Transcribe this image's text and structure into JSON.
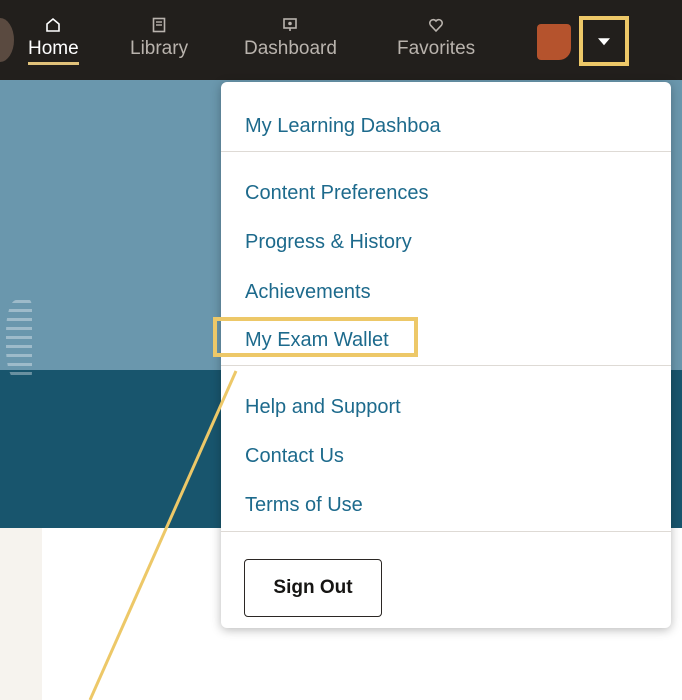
{
  "nav": {
    "items": [
      {
        "label": "Home",
        "icon": "home-icon",
        "active": true
      },
      {
        "label": "Library",
        "icon": "library-icon"
      },
      {
        "label": "Dashboard",
        "icon": "dashboard-icon"
      },
      {
        "label": "Favorites",
        "icon": "heart-icon"
      }
    ]
  },
  "menu": {
    "items": [
      {
        "label": "My Learning Dashboa"
      },
      {
        "label": "Content Preferences"
      },
      {
        "label": "Progress & History"
      },
      {
        "label": "Achievements"
      },
      {
        "label": "My Exam Wallet"
      },
      {
        "label": "Help and Support"
      },
      {
        "label": "Contact Us"
      },
      {
        "label": "Terms of Use"
      }
    ],
    "sign_out": "Sign Out"
  },
  "colors": {
    "nav_bg": "#221f1c",
    "highlight": "#edc868",
    "link": "#1d6a8c",
    "hero_light": "#6a97ad",
    "hero_dark": "#18556d",
    "avatar": "#b5532d"
  }
}
